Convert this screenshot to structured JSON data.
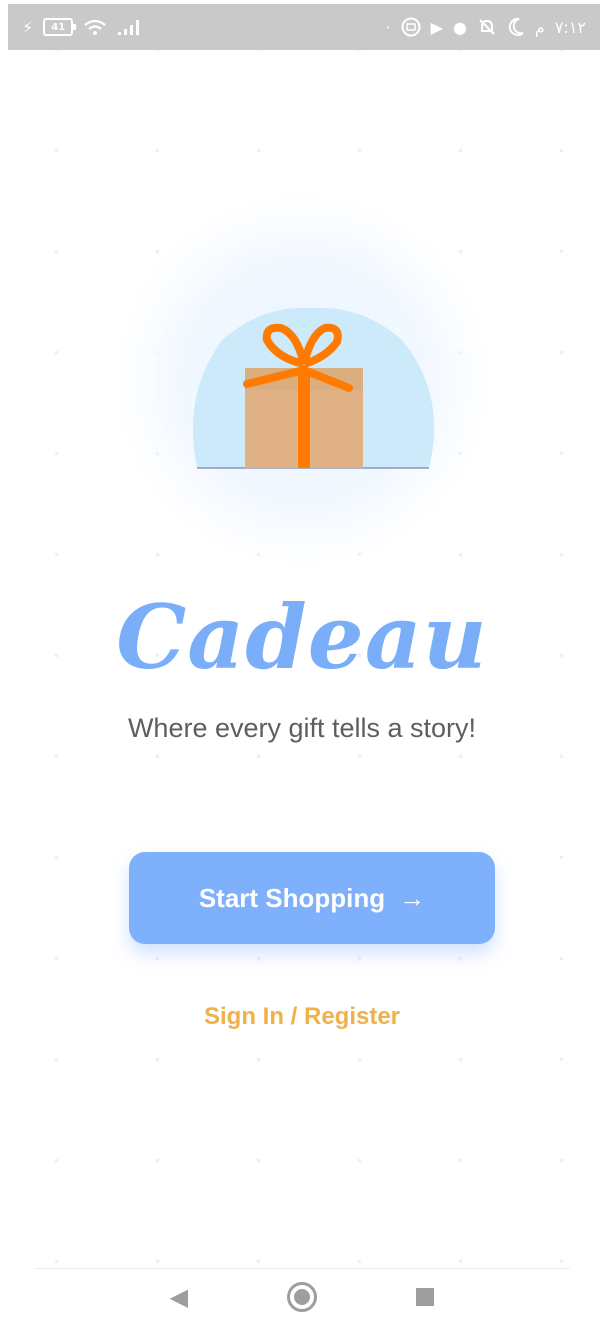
{
  "status_bar": {
    "battery": "41",
    "time": "٧:١٢",
    "ampm": "م",
    "icons": [
      "charging-icon",
      "battery-icon",
      "wifi-icon",
      "signal-icon",
      "dot-icon",
      "mi-icon",
      "play-icon",
      "circle-app-icon",
      "mute-icon",
      "moon-icon"
    ]
  },
  "app": {
    "brand": "Cadeau",
    "tagline": "Where every gift tells a story!",
    "cta_label": "Start Shopping",
    "cta_arrow": "→",
    "signin_label": "Sign In / Register"
  },
  "colors": {
    "accent": "#7eb0fb",
    "brand": "#7aaef8",
    "link": "#f0b14a",
    "gift_box": "#dfb185",
    "ribbon": "#ff7a00",
    "blob": "#cdeafb"
  },
  "nav": {
    "icons": [
      "back-icon",
      "home-icon",
      "recents-icon"
    ]
  }
}
